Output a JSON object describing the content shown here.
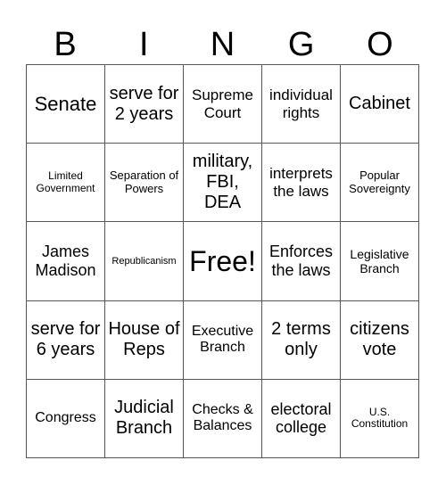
{
  "header": [
    "B",
    "I",
    "N",
    "G",
    "O"
  ],
  "cells": [
    [
      "Senate",
      "serve for 2 years",
      "Supreme Court",
      "individual rights",
      "Cabinet"
    ],
    [
      "Limited Government",
      "Separation of Powers",
      "military, FBI, DEA",
      "interprets the laws",
      "Popular Sovereignty"
    ],
    [
      "James Madison",
      "Republicanism",
      "Free!",
      "Enforces the laws",
      "Legislative Branch"
    ],
    [
      "serve for 6 years",
      "House of Reps",
      "Executive Branch",
      "2 terms only",
      "citizens vote"
    ],
    [
      "Congress",
      "Judicial Branch",
      "Checks & Balances",
      "electoral college",
      "U.S. Constitution"
    ]
  ]
}
